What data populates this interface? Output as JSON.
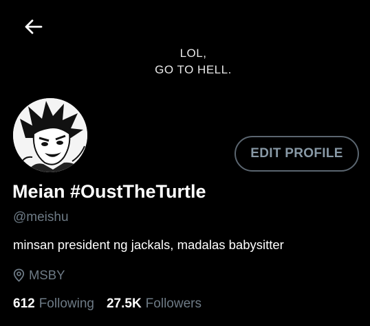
{
  "banner": {
    "line1": "LOL,",
    "line2": "GO TO HELL."
  },
  "icons": {
    "back": "arrow-left-icon",
    "location": "location-pin-icon"
  },
  "colors": {
    "background": "#000000",
    "text_primary": "#ffffff",
    "text_secondary": "#6e7b86",
    "button_border": "#5b6670",
    "button_text": "#8899a6"
  },
  "profile": {
    "edit_label": "EDIT PROFILE",
    "display_name": "Meian #OustTheTurtle",
    "handle": "@meishu",
    "bio": "minsan president ng jackals, madalas babysitter",
    "location": "MSBY",
    "following_count": "612",
    "following_label": "Following",
    "followers_count": "27.5K",
    "followers_label": "Followers"
  }
}
